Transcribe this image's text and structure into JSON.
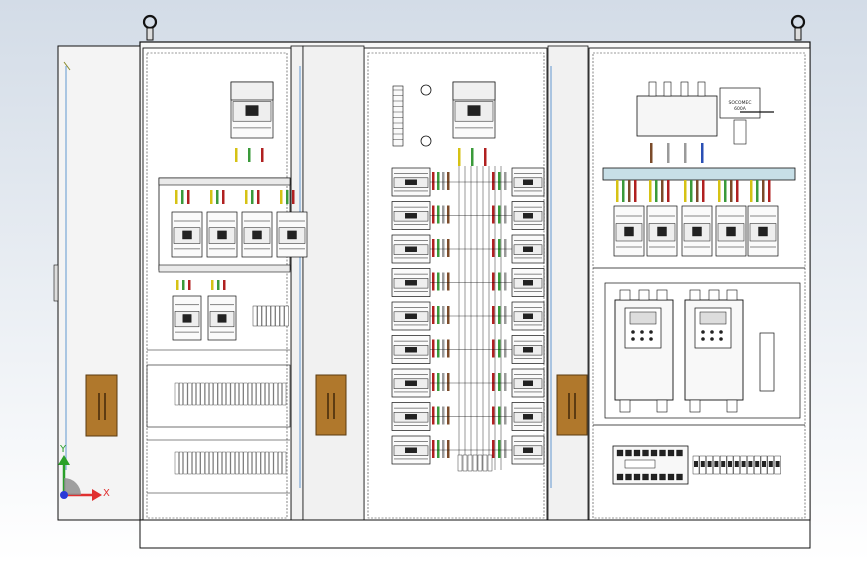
{
  "viewport": {
    "background_top": "#d3dce7",
    "background_bottom": "#ffffff"
  },
  "colors": {
    "frame": "#111111",
    "panel_fill": "#ffffff",
    "door_fill": "#f1f1f1",
    "gland_fill": "#e6e6e6",
    "handle_wood": "#b0782c",
    "rail": "#eaeaea",
    "wire_red": "#b02020",
    "wire_green": "#3a9a3a",
    "wire_yellow": "#d6c214",
    "wire_blue": "#2a4fb4",
    "wire_gray": "#9a9a9a",
    "wire_brown": "#7b4b2a",
    "busbar": "#c7dfe7",
    "hinge_blue": "#7aa7d6"
  },
  "triad": {
    "x_label": "X",
    "y_label": "Y",
    "x_color": "#e03030",
    "y_color": "#2aa02a",
    "z_color": "#2a3ad8"
  },
  "labels": {
    "switch_plate_line1": "SOCOMEC",
    "switch_plate_line2": "600A"
  },
  "icons": [
    "lifting-eye-icon",
    "coordinate-triad-icon",
    "door-handle-icon"
  ]
}
